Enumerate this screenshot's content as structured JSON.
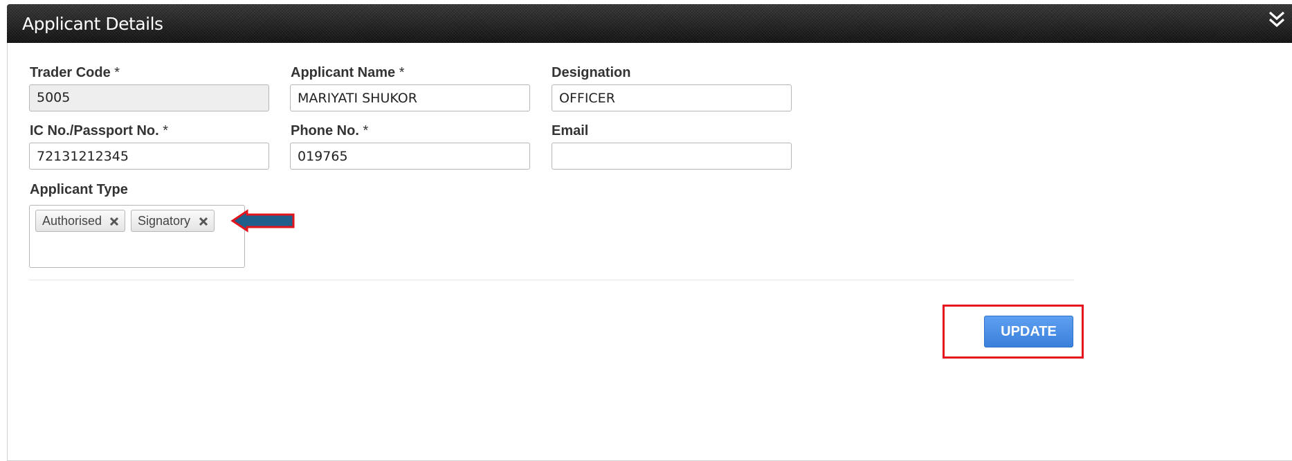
{
  "panel": {
    "title": "Applicant Details"
  },
  "form": {
    "trader_code": {
      "label": "Trader Code",
      "required_mark": " *",
      "value": "5005"
    },
    "applicant_name": {
      "label": "Applicant Name",
      "required_mark": " *",
      "value": "MARIYATI SHUKOR"
    },
    "designation": {
      "label": "Designation",
      "value": "OFFICER"
    },
    "ic_passport": {
      "label": "IC No./Passport No.",
      "required_mark": " *",
      "value": "72131212345"
    },
    "phone": {
      "label": "Phone No.",
      "required_mark": " *",
      "value": "019765"
    },
    "email": {
      "label": "Email",
      "value": ""
    },
    "applicant_type": {
      "label": "Applicant Type",
      "selected": [
        {
          "label": "Authorised"
        },
        {
          "label": "Signatory"
        }
      ]
    }
  },
  "actions": {
    "update_label": "UPDATE"
  },
  "icons": {
    "collapse": "double-chevron-down-icon",
    "tag_remove": "close-icon",
    "annotation_arrow": "arrow-left-icon"
  },
  "colors": {
    "header_bg": "#2b2b2b",
    "button_blue": "#3a7fdc",
    "annotation_red": "#e3141b",
    "arrow_fill": "#1f5f8b"
  }
}
